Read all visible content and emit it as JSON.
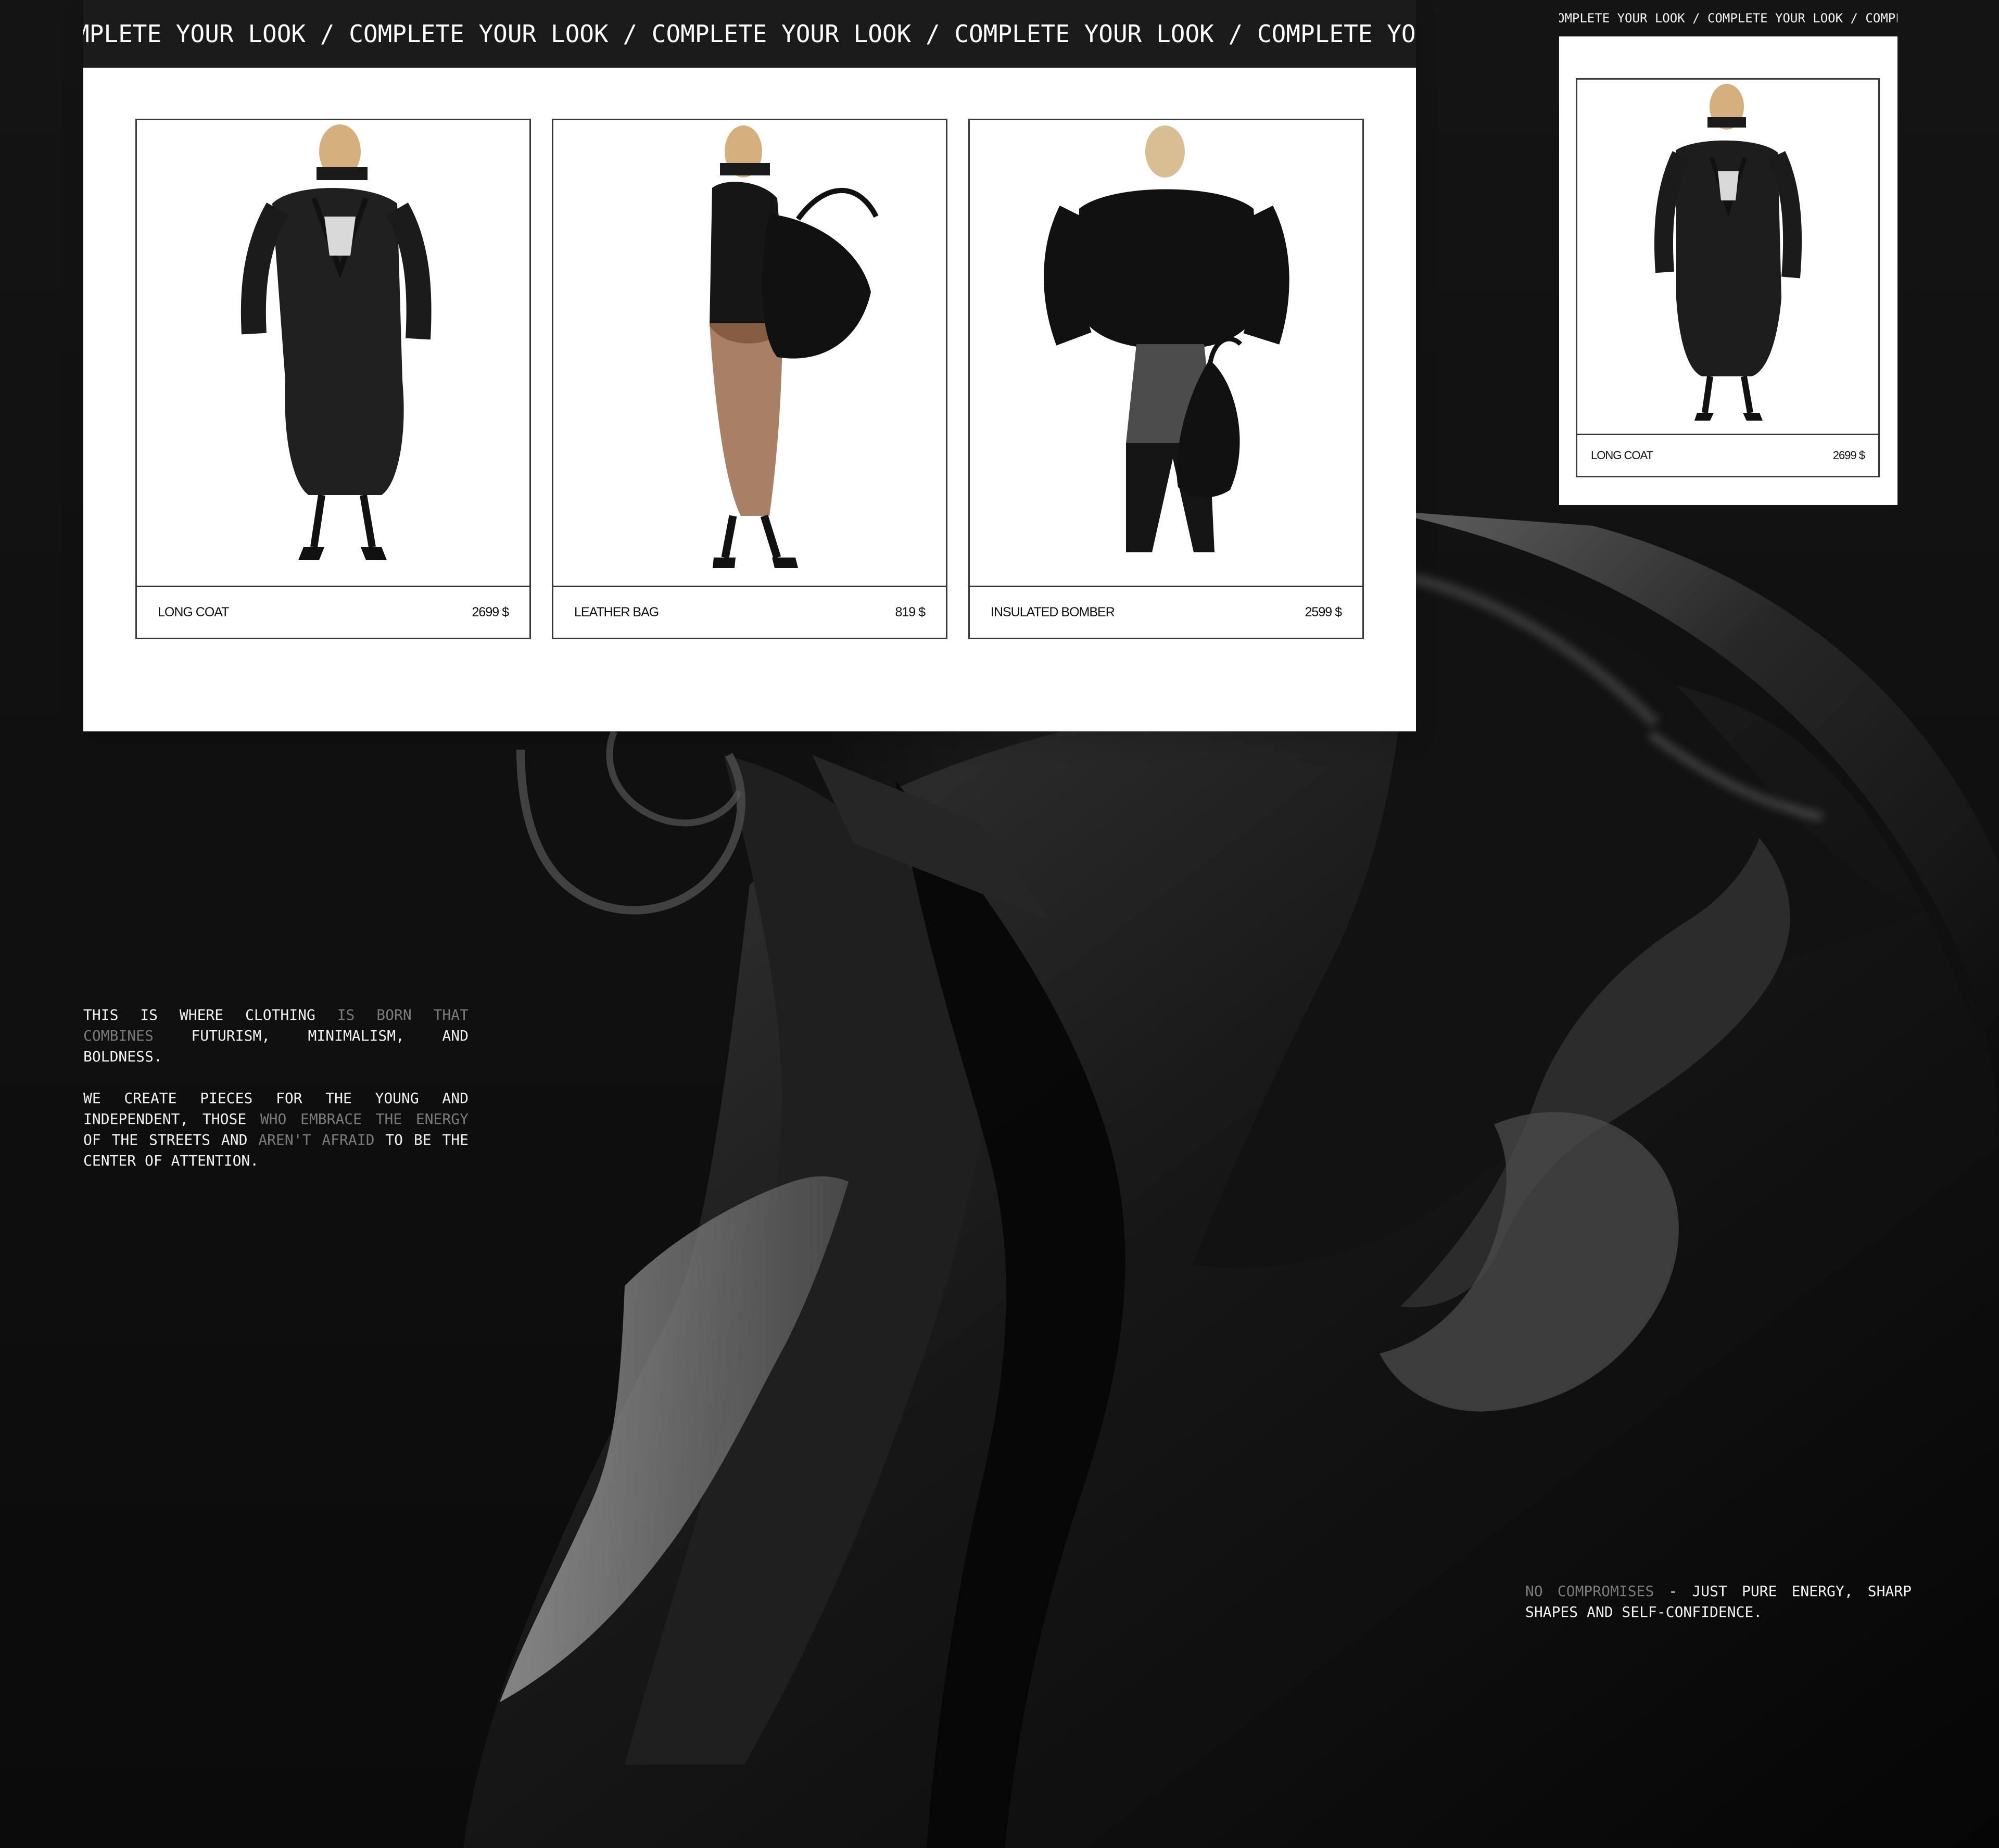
{
  "desktop": {
    "marquee": "MPLETE YOUR LOOK / COMPLETE YOUR LOOK / COMPLETE YOUR LOOK / COMPLETE YOUR LOOK / COMPLETE YOUR LOC",
    "products": [
      {
        "name": "LONG COAT",
        "price": "2699 $"
      },
      {
        "name": "LEATHER BAG",
        "price": "819 $"
      },
      {
        "name": "INSULATED BOMBER",
        "price": "2599 $"
      }
    ]
  },
  "mobile": {
    "marquee": "OMPLETE YOUR LOOK / COMPLETE YOUR LOOK / COMPLETE YC",
    "product": {
      "name": "LONG COAT",
      "price": "2699 $"
    }
  },
  "copy": {
    "block1": {
      "p1a": "THIS IS WHERE CLOTHING ",
      "p1b": "IS BORN THAT COMBINES",
      "p1c": " FUTURISM, MINIMALISM, AND BOLDNESS.",
      "p2a": "WE CREATE PIECES FOR THE YOUNG AND INDEPENDENT, THOSE ",
      "p2b": "WHO EMBRACE THE ENERGY",
      "p2c": " OF THE STREETS AND ",
      "p2d": "AREN'T AFRAID",
      "p2e": " TO BE THE CENTER OF ATTENTION."
    },
    "block2": {
      "a": "NO COMPROMISES",
      "b": " - JUST PURE ENERGY, SHARP SHAPES AND SELF-CONFIDENCE."
    }
  },
  "colors": {
    "background": "#111111",
    "surface": "#ffffff",
    "marquee": "#1b1b1b",
    "muted_text": "#7b7b7b"
  }
}
